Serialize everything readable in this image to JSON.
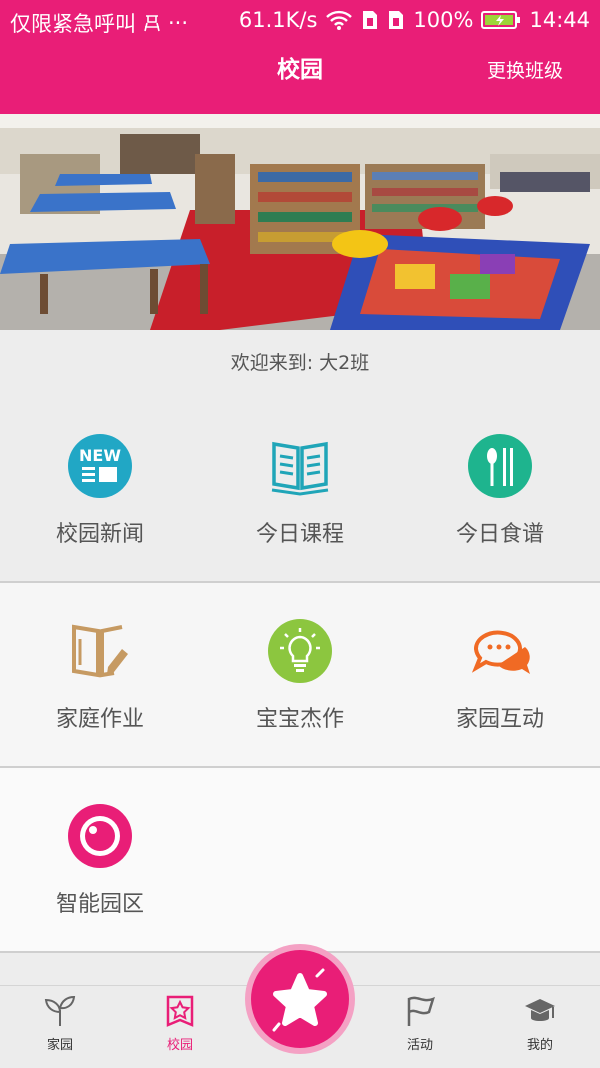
{
  "status": {
    "notification_text": "仅限紧急呼叫",
    "more": "···",
    "speed": "61.1K/s",
    "battery_percent": "100%",
    "time": "14:44"
  },
  "header": {
    "title": "校园",
    "switch_class": "更换班级"
  },
  "banner": {
    "page_count": 2,
    "active_index": 0
  },
  "welcome": "欢迎来到: 大2班",
  "grid": [
    {
      "label": "校园新闻",
      "icon": "new-news-icon",
      "color": "#21a7c5"
    },
    {
      "label": "今日课程",
      "icon": "book-icon",
      "color": "#20a5b8"
    },
    {
      "label": "今日食谱",
      "icon": "recipe-icon",
      "color": "#1eb48e"
    },
    {
      "label": "家庭作业",
      "icon": "homework-icon",
      "color": "#c69a62"
    },
    {
      "label": "宝宝杰作",
      "icon": "lightbulb-icon",
      "color": "#8cc63f"
    },
    {
      "label": "家园互动",
      "icon": "chat-icon",
      "color": "#f06a24"
    },
    {
      "label": "智能园区",
      "icon": "camera-icon",
      "color": "#e91e77"
    }
  ],
  "tabs": [
    {
      "label": "家园",
      "icon": "sprout-icon"
    },
    {
      "label": "校园",
      "icon": "school-star-icon",
      "active": true
    },
    {
      "label": "活动",
      "icon": "flag-icon"
    },
    {
      "label": "我的",
      "icon": "graduation-cap-icon"
    }
  ],
  "fab_icon": "star-icon",
  "colors": {
    "accent": "#e91e77",
    "background": "#ededed"
  }
}
